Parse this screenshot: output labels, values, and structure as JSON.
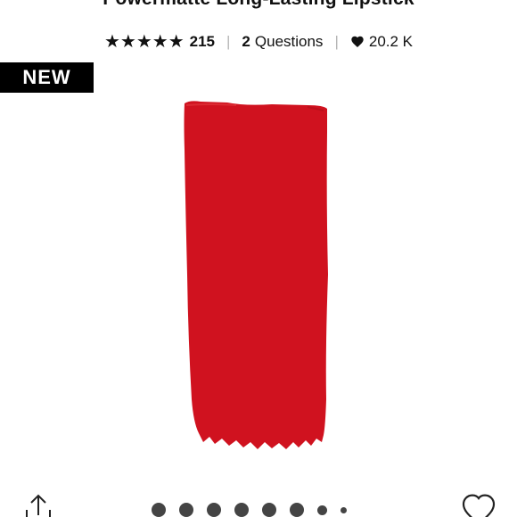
{
  "product": {
    "title": "Powermatte Long-Lasting Lipstick"
  },
  "reviews": {
    "rating_stars": "★★★★★",
    "count": "215"
  },
  "questions": {
    "count": "2",
    "label": "Questions"
  },
  "loves": {
    "count": "20.2 K",
    "icon": "heart-icon"
  },
  "badge": {
    "label": "NEW"
  },
  "swatch": {
    "color": "#d0121f"
  },
  "carousel": {
    "total_dots": 8,
    "active_index": 0
  },
  "icons": {
    "share": "share-icon",
    "love": "heart-outline-icon"
  }
}
